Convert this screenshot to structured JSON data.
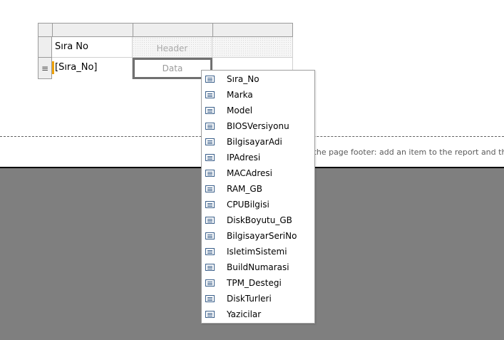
{
  "tablix": {
    "header_text": "Sıra No",
    "header_placeholder": "Header",
    "data_expression": "[Sıra_No]",
    "data_placeholder": "Data",
    "row_glyph": "≡"
  },
  "footer_hint": "to the page footer: add an item to the report and ther",
  "field_list": {
    "icon": "field-icon",
    "items": [
      "Sıra_No",
      "Marka",
      "Model",
      "BIOSVersiyonu",
      "BilgisayarAdi",
      "IPAdresi",
      "MACAdresi",
      "RAM_GB",
      "CPUBilgisi",
      "DiskBoyutu_GB",
      "BilgisayarSeriNo",
      "IsletimSistemi",
      "BuildNumarasi",
      "TPM_Destegi",
      "DiskTurleri",
      "Yazicilar"
    ]
  },
  "colors": {
    "canvas_background": "#7f7f7f",
    "field_marker": "#f0a30a",
    "icon_stroke": "#3a5f8a"
  }
}
